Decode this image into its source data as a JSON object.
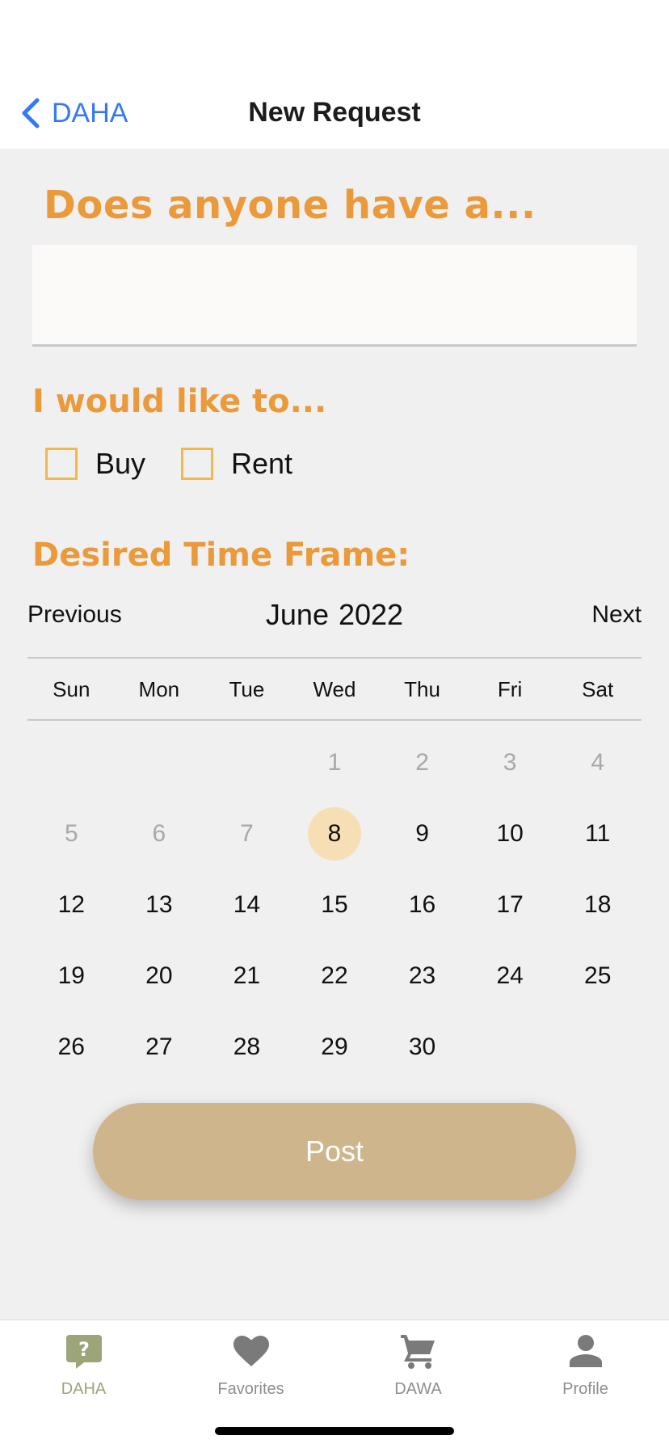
{
  "nav": {
    "back_label": "DAHA",
    "title": "New Request"
  },
  "form": {
    "question_label": "Does anyone have a...",
    "question_value": "",
    "like_label": "I would like to...",
    "options": [
      {
        "label": "Buy",
        "checked": false
      },
      {
        "label": "Rent",
        "checked": false
      }
    ],
    "timeframe_label": "Desired Time Frame:"
  },
  "calendar": {
    "prev_label": "Previous",
    "next_label": "Next",
    "month": "June",
    "year": "2022",
    "weekdays": [
      "Sun",
      "Mon",
      "Tue",
      "Wed",
      "Thu",
      "Fri",
      "Sat"
    ],
    "weeks": [
      [
        null,
        null,
        null,
        "1",
        "2",
        "3",
        "4"
      ],
      [
        "5",
        "6",
        "7",
        "8",
        "9",
        "10",
        "11"
      ],
      [
        "12",
        "13",
        "14",
        "15",
        "16",
        "17",
        "18"
      ],
      [
        "19",
        "20",
        "21",
        "22",
        "23",
        "24",
        "25"
      ],
      [
        "26",
        "27",
        "28",
        "29",
        "30",
        null,
        null
      ]
    ],
    "disabled_days": [
      "1",
      "2",
      "3",
      "4",
      "5",
      "6",
      "7"
    ],
    "selected_day": "8"
  },
  "post_label": "Post",
  "tabs": [
    {
      "label": "DAHA",
      "icon": "question-bubble-icon",
      "active": true
    },
    {
      "label": "Favorites",
      "icon": "heart-icon",
      "active": false
    },
    {
      "label": "DAWA",
      "icon": "cart-icon",
      "active": false
    },
    {
      "label": "Profile",
      "icon": "person-icon",
      "active": false
    }
  ],
  "colors": {
    "accent_orange": "#ea9a3b",
    "checkbox_border": "#f2b84a",
    "selected_day_bg": "#f6dfb5",
    "post_button": "#cfb58b",
    "tab_active": "#9ba577",
    "link_blue": "#3478f6"
  }
}
